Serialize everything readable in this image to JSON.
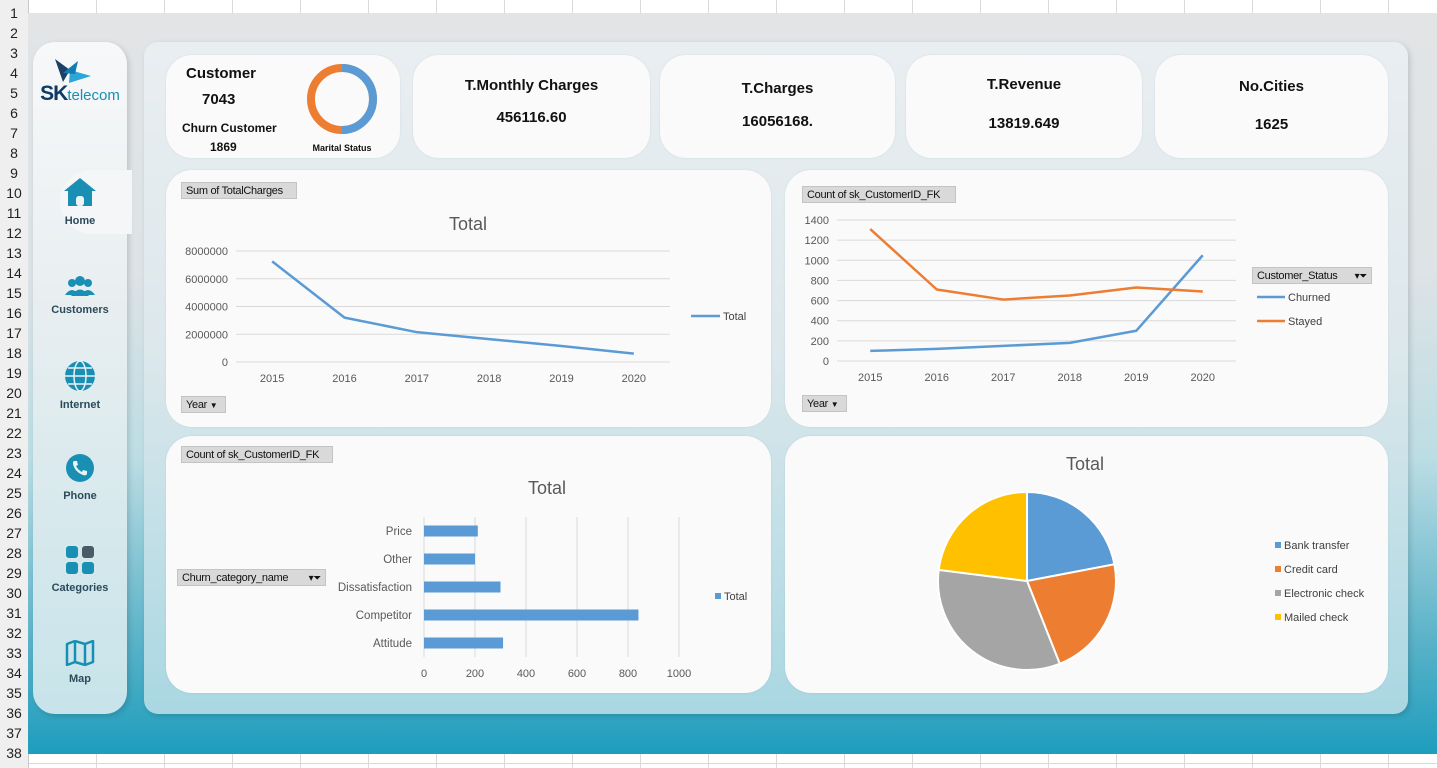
{
  "row_numbers": [
    "1",
    "2",
    "3",
    "4",
    "5",
    "6",
    "7",
    "8",
    "9",
    "10",
    "11",
    "12",
    "13",
    "14",
    "15",
    "16",
    "17",
    "18",
    "19",
    "20",
    "21",
    "22",
    "23",
    "24",
    "25",
    "26",
    "27",
    "28",
    "29",
    "30",
    "31",
    "32",
    "33",
    "34",
    "35",
    "36",
    "37",
    "38"
  ],
  "brand": {
    "logo_text_bold": "SK",
    "logo_text_rest": "telecom",
    "colors": {
      "primary": "#1a8fb4",
      "accent": "#ed7d31"
    }
  },
  "nav": [
    {
      "label": "Home",
      "icon": "home-icon"
    },
    {
      "label": "Customers",
      "icon": "users-icon"
    },
    {
      "label": "Internet",
      "icon": "globe-icon"
    },
    {
      "label": "Phone",
      "icon": "phone-icon"
    },
    {
      "label": "Categories",
      "icon": "grid-icon"
    },
    {
      "label": "Map",
      "icon": "map-icon"
    }
  ],
  "kpi_customer": {
    "title": "Customer",
    "value": "7043",
    "churn_title": "Churn Customer",
    "churn_value": "1869",
    "donut_label": "Marital Status"
  },
  "kpis": [
    {
      "title": "T.Monthly Charges",
      "value": "456116.60"
    },
    {
      "title": "T.Charges",
      "value": "16056168."
    },
    {
      "title": "T.Revenue",
      "value": "13819.649"
    },
    {
      "title": "No.Cities",
      "value": "1625"
    }
  ],
  "chart_data": [
    {
      "id": "charges_by_year",
      "type": "line",
      "field_button": "Sum of TotalCharges",
      "axis_button": "Year",
      "title": "Total",
      "categories": [
        "2015",
        "2016",
        "2017",
        "2018",
        "2019",
        "2020"
      ],
      "series": [
        {
          "name": "Total",
          "color": "#5b9bd5",
          "values": [
            7250000,
            3200000,
            2150000,
            1650000,
            1150000,
            600000
          ]
        }
      ],
      "ylim": [
        0,
        8000000
      ],
      "yticks": [
        "0",
        "2000000",
        "4000000",
        "6000000",
        "8000000"
      ],
      "grid": true,
      "legend": "right"
    },
    {
      "id": "customers_by_status",
      "type": "line",
      "field_button": "Count of sk_CustomerID_FK",
      "axis_button": "Year",
      "filter_button": "Customer_Status",
      "title": "",
      "categories": [
        "2015",
        "2016",
        "2017",
        "2018",
        "2019",
        "2020"
      ],
      "series": [
        {
          "name": "Churned",
          "color": "#5b9bd5",
          "values": [
            100,
            120,
            150,
            180,
            300,
            1050
          ]
        },
        {
          "name": "Stayed",
          "color": "#ed7d31",
          "values": [
            1310,
            710,
            610,
            650,
            730,
            690
          ]
        }
      ],
      "ylim": [
        0,
        1400
      ],
      "yticks": [
        "0",
        "200",
        "400",
        "600",
        "800",
        "1000",
        "1200",
        "1400"
      ],
      "grid": true,
      "legend": "right"
    },
    {
      "id": "churn_category",
      "type": "bar",
      "orientation": "horizontal",
      "field_button": "Count of sk_CustomerID_FK",
      "filter_button": "Churn_category_name",
      "title": "Total",
      "categories": [
        "Price",
        "Other",
        "Dissatisfaction",
        "Competitor",
        "Attitude"
      ],
      "series": [
        {
          "name": "Total",
          "color": "#5b9bd5",
          "values": [
            211,
            200,
            300,
            841,
            310
          ]
        }
      ],
      "xlim": [
        0,
        1000
      ],
      "xticks": [
        "0",
        "200",
        "400",
        "600",
        "800",
        "1000"
      ],
      "grid": true,
      "legend": "right"
    },
    {
      "id": "payment_method",
      "type": "pie",
      "title": "Total",
      "labels": [
        "Bank transfer",
        "Credit card",
        "Electronic check",
        "Mailed check"
      ],
      "values": [
        22,
        22,
        33,
        23
      ],
      "colors": [
        "#5b9bd5",
        "#ed7d31",
        "#a5a5a5",
        "#ffc000"
      ],
      "legend": "right"
    }
  ],
  "donut": {
    "segments": [
      {
        "value": 50,
        "color": "#5b9bd5"
      },
      {
        "value": 50,
        "color": "#ed7d31"
      }
    ]
  }
}
